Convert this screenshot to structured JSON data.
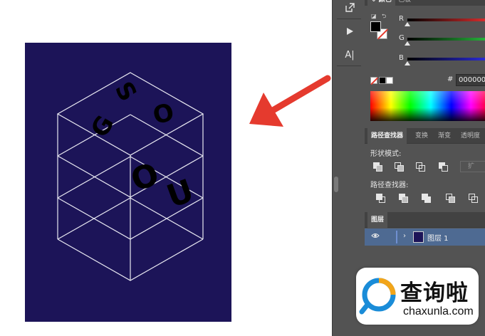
{
  "canvas": {
    "artboard_color": "#1c1458",
    "artwork_letters": [
      "S",
      "O",
      "G",
      "O",
      "U"
    ]
  },
  "toolstrip": {
    "tools": [
      "export-icon",
      "play-icon",
      "type-area-icon"
    ],
    "type_label": "A|"
  },
  "color_panel": {
    "tab_label": "颜色",
    "tab2_label": "色板",
    "channels": [
      {
        "label": "R",
        "value_fraction": 0.0,
        "color": "#d62c2c"
      },
      {
        "label": "G",
        "value_fraction": 0.0,
        "color": "#27b23a"
      },
      {
        "label": "B",
        "value_fraction": 0.0,
        "color": "#2a2ad6"
      }
    ],
    "hash": "#",
    "hex_value": "000000"
  },
  "pathfinder": {
    "tabs": [
      "路径查找器",
      "变换",
      "渐变",
      "透明度"
    ],
    "shape_modes_label": "形状模式:",
    "expand_label": "扩",
    "pathfinders_label": "路径查找器:"
  },
  "layers_panel": {
    "tab_label": "图层",
    "layer_name": "图层 1"
  },
  "watermark": {
    "cn": "查询啦",
    "en": "chaxunla.com"
  },
  "colors": {
    "panel_bg": "#535353",
    "accent_red": "#e53a2e",
    "selection_blue": "#4e6a92"
  }
}
